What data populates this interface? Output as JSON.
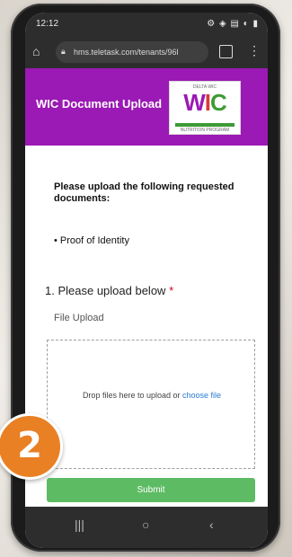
{
  "status_bar": {
    "time": "12:12",
    "icons": "⚙ ◈ ▤ ◐ ▮"
  },
  "browser": {
    "url": "hms.teletask.com/tenants/96l"
  },
  "header": {
    "title": "WIC Document Upload",
    "logo_top": "DELTA WIC",
    "logo_letters": {
      "w": "W",
      "i": "I",
      "c": "C"
    },
    "logo_bottom": "NUTRITION PROGRAM"
  },
  "form": {
    "intro": "Please upload the following requested documents:",
    "bullet": "• Proof of Identity",
    "question": "1. Please upload below",
    "required_mark": "*",
    "field_label": "File Upload",
    "dropzone_text": "Drop files here to upload or ",
    "dropzone_link": "choose file",
    "submit_label": "Submit"
  },
  "navbar": {
    "recent": "|||",
    "home": "○",
    "back": "‹"
  },
  "badge": {
    "number": "2"
  },
  "colors": {
    "header": "#9b19b4",
    "submit": "#5dbb63",
    "badge": "#e98024",
    "link": "#2a7bd3"
  }
}
